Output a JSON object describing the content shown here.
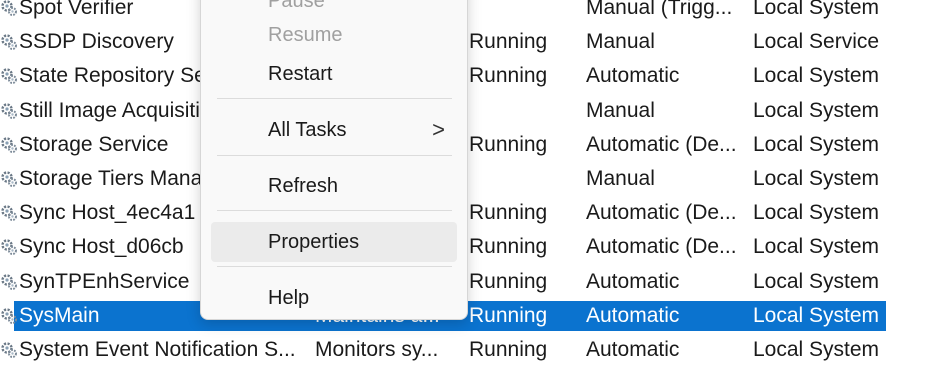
{
  "services": [
    {
      "name": "Spot Verifier",
      "description": "",
      "status": "",
      "startup": "Manual (Trigg...",
      "logon": "Local System",
      "selected": false
    },
    {
      "name": "SSDP Discovery",
      "description": "",
      "status": "Running",
      "startup": "Manual",
      "logon": "Local Service",
      "selected": false
    },
    {
      "name": "State Repository Se",
      "description": "",
      "status": "Running",
      "startup": "Automatic",
      "logon": "Local System",
      "selected": false
    },
    {
      "name": "Still Image Acquisiti",
      "description": "",
      "status": "",
      "startup": "Manual",
      "logon": "Local System",
      "selected": false
    },
    {
      "name": "Storage Service",
      "description": "",
      "status": "Running",
      "startup": "Automatic (De...",
      "logon": "Local System",
      "selected": false
    },
    {
      "name": "Storage Tiers Mana",
      "description": "",
      "status": "",
      "startup": "Manual",
      "logon": "Local System",
      "selected": false
    },
    {
      "name": "Sync Host_4ec4a1",
      "description": "",
      "status": "Running",
      "startup": "Automatic (De...",
      "logon": "Local System",
      "selected": false
    },
    {
      "name": "Sync Host_d06cb",
      "description": "",
      "status": "Running",
      "startup": "Automatic (De...",
      "logon": "Local System",
      "selected": false
    },
    {
      "name": "SynTPEnhService",
      "description": "",
      "status": "Running",
      "startup": "Automatic",
      "logon": "Local System",
      "selected": false
    },
    {
      "name": "SysMain",
      "description": "Maintains a...",
      "status": "Running",
      "startup": "Automatic",
      "logon": "Local System",
      "selected": true
    },
    {
      "name": "System Event Notification S...",
      "description": "Monitors sy...",
      "status": "Running",
      "startup": "Automatic",
      "logon": "Local System",
      "selected": false
    }
  ],
  "context_menu": {
    "pause_label": "Pause",
    "resume_label": "Resume",
    "restart_label": "Restart",
    "all_tasks_label": "All Tasks",
    "all_tasks_chevron": ">",
    "refresh_label": "Refresh",
    "properties_label": "Properties",
    "help_label": "Help"
  },
  "colors": {
    "selection": "#0b73cf",
    "menu_background": "#f9f9f9",
    "menu_hover": "#ebebeb",
    "disabled_text": "#a0a0a0"
  },
  "icons": {
    "service": "gear-icon",
    "submenu": "chevron-right-icon"
  }
}
